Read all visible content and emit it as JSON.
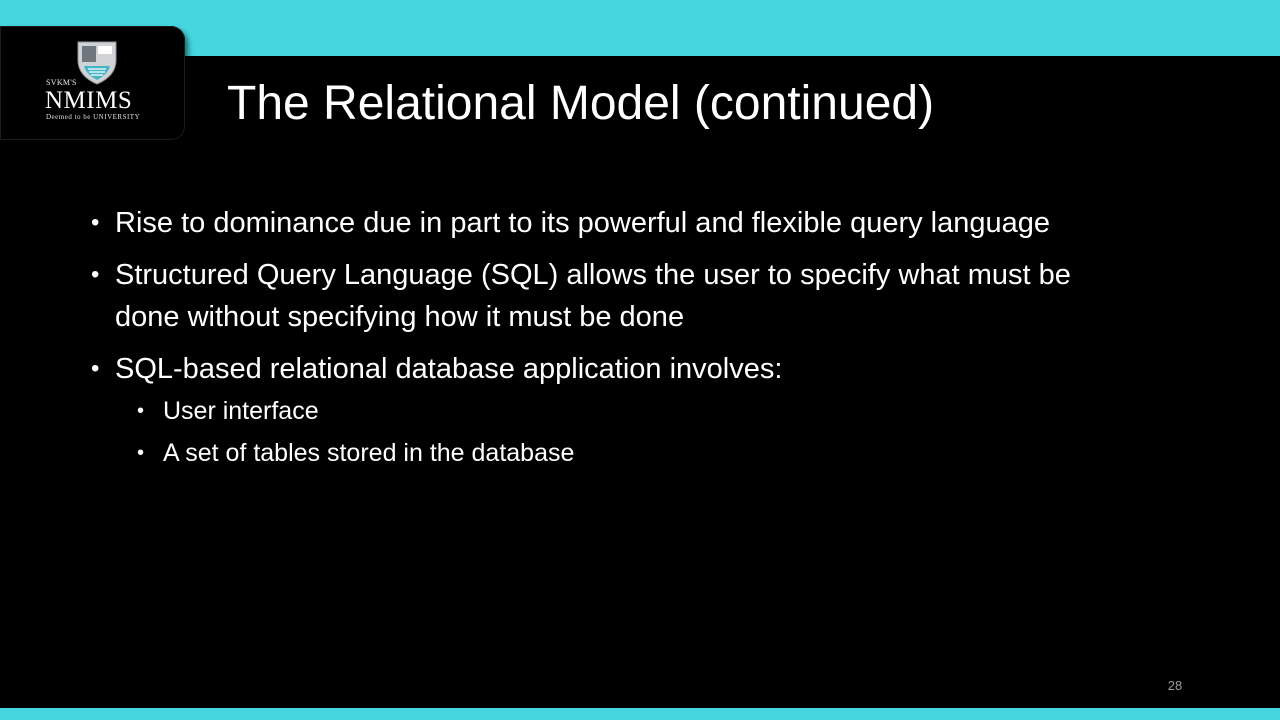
{
  "logo": {
    "svkm": "SVKM'S",
    "name": "NMIMS",
    "tagline": "Deemed to be UNIVERSITY"
  },
  "slide": {
    "title": "The Relational Model (continued)",
    "bullets": [
      {
        "text": "Rise to dominance due in part to its powerful and flexible query language"
      },
      {
        "text": "Structured Query Language (SQL) allows the user to specify what must be done without specifying how it must be done"
      },
      {
        "text": "SQL-based relational database application involves:",
        "sub": [
          "User interface",
          "A set of tables stored in the database"
        ]
      }
    ],
    "bullet_glyph": "•",
    "page_number": "28"
  },
  "colors": {
    "accent": "#45d6e0",
    "background": "#000000",
    "text": "#ffffff"
  }
}
